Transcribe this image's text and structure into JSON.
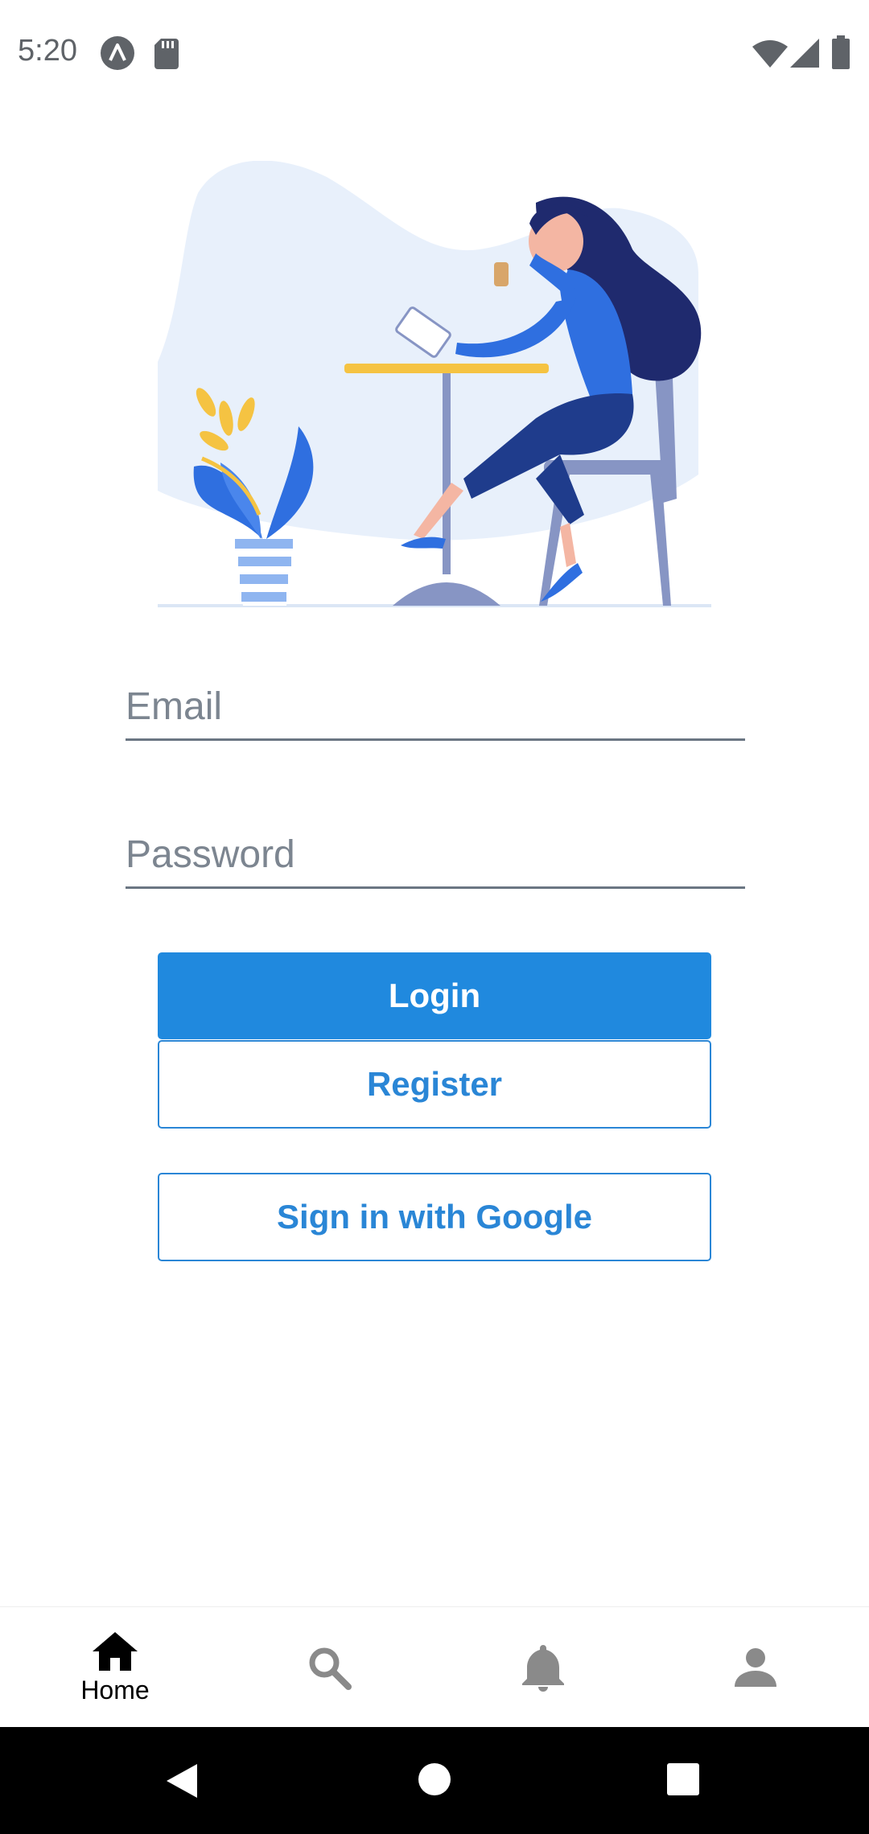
{
  "status_bar": {
    "time": "5:20"
  },
  "login_form": {
    "email_placeholder": "Email",
    "password_placeholder": "Password",
    "login_label": "Login",
    "register_label": "Register",
    "google_label": "Sign in with Google"
  },
  "bottom_nav": {
    "items": [
      {
        "label": "Home",
        "icon": "home-icon",
        "active": true
      },
      {
        "label": "",
        "icon": "search-icon",
        "active": false
      },
      {
        "label": "",
        "icon": "bell-icon",
        "active": false
      },
      {
        "label": "",
        "icon": "person-icon",
        "active": false
      }
    ]
  },
  "colors": {
    "primary": "#2089de",
    "outline": "#2a86d6",
    "nav_active": "#000000",
    "nav_inactive": "#8a8a8a"
  }
}
